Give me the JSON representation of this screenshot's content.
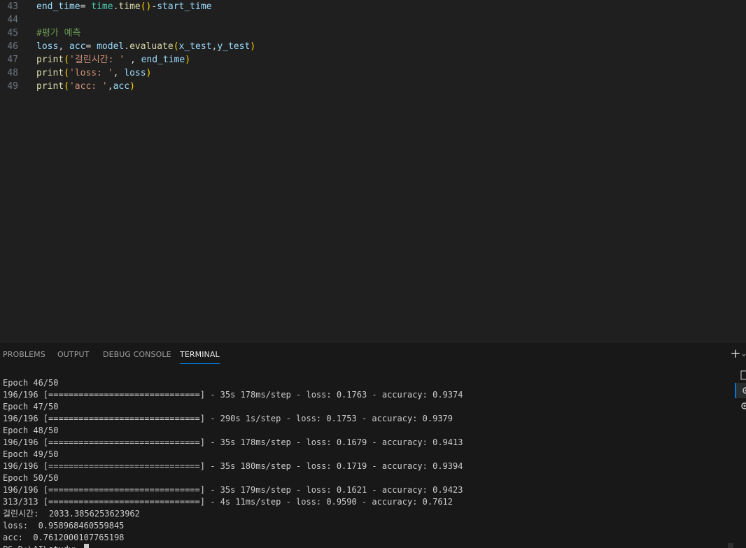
{
  "editor": {
    "lines": [
      {
        "num": "43",
        "tokens": [
          {
            "t": "end_time",
            "c": "var"
          },
          {
            "t": "= ",
            "c": "op"
          },
          {
            "t": "time",
            "c": "mod"
          },
          {
            "t": ".",
            "c": "op"
          },
          {
            "t": "time",
            "c": "fn"
          },
          {
            "t": "()",
            "c": "br1"
          },
          {
            "t": "-",
            "c": "op"
          },
          {
            "t": "start_time",
            "c": "var"
          }
        ]
      },
      {
        "num": "44",
        "tokens": []
      },
      {
        "num": "45",
        "tokens": [
          {
            "t": "#평가 예측",
            "c": "cmt"
          }
        ]
      },
      {
        "num": "46",
        "tokens": [
          {
            "t": "loss",
            "c": "var"
          },
          {
            "t": ", ",
            "c": "op"
          },
          {
            "t": "acc",
            "c": "var"
          },
          {
            "t": "= ",
            "c": "op"
          },
          {
            "t": "model",
            "c": "var"
          },
          {
            "t": ".",
            "c": "op"
          },
          {
            "t": "evaluate",
            "c": "fn"
          },
          {
            "t": "(",
            "c": "br1"
          },
          {
            "t": "x_test",
            "c": "var"
          },
          {
            "t": ",",
            "c": "op"
          },
          {
            "t": "y_test",
            "c": "var"
          },
          {
            "t": ")",
            "c": "br1"
          }
        ]
      },
      {
        "num": "47",
        "tokens": [
          {
            "t": "print",
            "c": "fn"
          },
          {
            "t": "(",
            "c": "br1"
          },
          {
            "t": "'걸린시간: '",
            "c": "str"
          },
          {
            "t": " , ",
            "c": "op"
          },
          {
            "t": "end_time",
            "c": "var"
          },
          {
            "t": ")",
            "c": "br1"
          }
        ]
      },
      {
        "num": "48",
        "tokens": [
          {
            "t": "print",
            "c": "fn"
          },
          {
            "t": "(",
            "c": "br1"
          },
          {
            "t": "'loss: '",
            "c": "str"
          },
          {
            "t": ", ",
            "c": "op"
          },
          {
            "t": "loss",
            "c": "var"
          },
          {
            "t": ")",
            "c": "br1"
          }
        ]
      },
      {
        "num": "49",
        "tokens": [
          {
            "t": "print",
            "c": "fn"
          },
          {
            "t": "(",
            "c": "br1"
          },
          {
            "t": "'acc: '",
            "c": "str"
          },
          {
            "t": ",",
            "c": "op"
          },
          {
            "t": "acc",
            "c": "var"
          },
          {
            "t": ")",
            "c": "br1"
          }
        ]
      }
    ]
  },
  "panel": {
    "tabs": [
      {
        "label": "PROBLEMS",
        "active": false
      },
      {
        "label": "OUTPUT",
        "active": false
      },
      {
        "label": "DEBUG CONSOLE",
        "active": false
      },
      {
        "label": "TERMINAL",
        "active": true
      }
    ],
    "plus_label": "+",
    "chevron_label": "⌄",
    "terminal_lines": [
      "Epoch 46/50",
      "196/196 [==============================] - 35s 178ms/step - loss: 0.1763 - accuracy: 0.9374",
      "Epoch 47/50",
      "196/196 [==============================] - 290s 1s/step - loss: 0.1753 - accuracy: 0.9379",
      "Epoch 48/50",
      "196/196 [==============================] - 35s 178ms/step - loss: 0.1679 - accuracy: 0.9413",
      "Epoch 49/50",
      "196/196 [==============================] - 35s 180ms/step - loss: 0.1719 - accuracy: 0.9394",
      "Epoch 50/50",
      "196/196 [==============================] - 35s 179ms/step - loss: 0.1621 - accuracy: 0.9423",
      "313/313 [==============================] - 4s 11ms/step - loss: 0.9590 - accuracy: 0.7612",
      "걸린시간:  2033.3856253623962",
      "loss:  0.958968460559845",
      "acc:  0.7612000107765198"
    ],
    "prompt": "PS D:\\AI\\study> ",
    "terminal_icons": [
      "terminal-icon",
      "gear-icon",
      "gear-icon"
    ]
  },
  "colors": {
    "editor_bg": "#1f1f1f",
    "panel_bg": "#181818",
    "accent": "#0078d4"
  }
}
